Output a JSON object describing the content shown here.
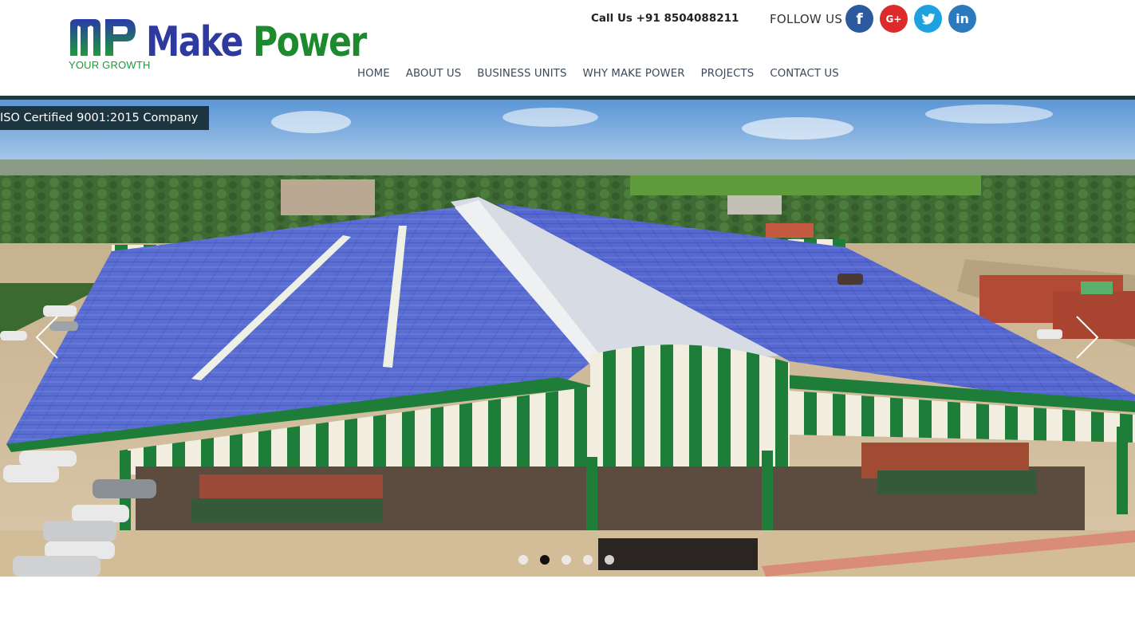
{
  "header": {
    "logo": {
      "tagline": "YOUR GROWTH",
      "name_part1": "Make",
      "name_part2": "Power",
      "colors": {
        "make": "#2e3a9e",
        "power": "#1e8a2e"
      }
    },
    "call_us": "Call Us +91 8504088211",
    "follow_label": "FOLLOW US",
    "social": [
      {
        "name": "facebook",
        "glyph": "f",
        "color": "#2d5a9e"
      },
      {
        "name": "google-plus",
        "glyph": "G+",
        "color": "#dd2a2a"
      },
      {
        "name": "twitter",
        "glyph": "twitter-bird",
        "color": "#1fa1e0"
      },
      {
        "name": "linkedin",
        "glyph": "in",
        "color": "#2b79be"
      }
    ]
  },
  "nav": {
    "items": [
      "HOME",
      "ABOUT US",
      "BUSINESS UNITS",
      "WHY MAKE POWER",
      "PROJECTS",
      "CONTACT US"
    ]
  },
  "hero": {
    "badge": "ISO Certified 9001:2015 Company",
    "slide_count": 5,
    "active_slide": 2,
    "prev_icon": "chevron-left-icon",
    "next_icon": "chevron-right-icon"
  }
}
